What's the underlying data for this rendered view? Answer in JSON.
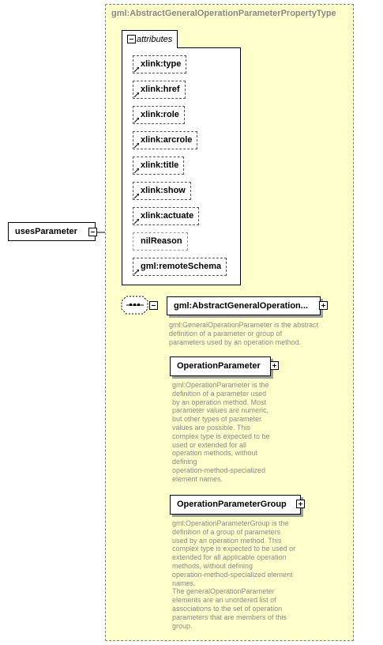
{
  "root": {
    "label": "usesParameter"
  },
  "type": {
    "title": "gml:AbstractGeneralOperationParameterPropertyType"
  },
  "attributes": {
    "title": "attributes",
    "items": [
      "xlink:type",
      "xlink:href",
      "xlink:role",
      "xlink:arcrole",
      "xlink:title",
      "xlink:show",
      "xlink:actuate",
      "nilReason",
      "gml:remoteSchema"
    ]
  },
  "element": {
    "label": "gml:AbstractGeneralOperation...",
    "doc": [
      "gml:GeneralOperationParameter is the abstract",
      "definition of a parameter or group of",
      "parameters used by an operation method."
    ]
  },
  "substitutes": [
    {
      "label": "OperationParameter",
      "doc": [
        "gml:OperationParameter is the",
        "definition of a parameter used",
        "by an operation method. Most",
        "parameter values are numeric,",
        "but other types of parameter",
        "values are possible. This",
        "complex type is expected to be",
        "used or extended for all",
        "operation methods, without",
        "defining",
        "operation-method-specialized",
        "element names."
      ]
    },
    {
      "label": "OperationParameterGroup",
      "doc": [
        "gml:OperationParameterGroup is the",
        "definition of a group of parameters",
        "used by an operation method. This",
        "complex type is expected to be used or",
        "extended for all applicable operation",
        "methods, without defining",
        "operation-method-specialized element",
        "names.",
        "The generalOperationParameter",
        "elements are an unordered list of",
        "associations to the set of operation",
        "parameters that are members of this",
        "group."
      ]
    }
  ]
}
